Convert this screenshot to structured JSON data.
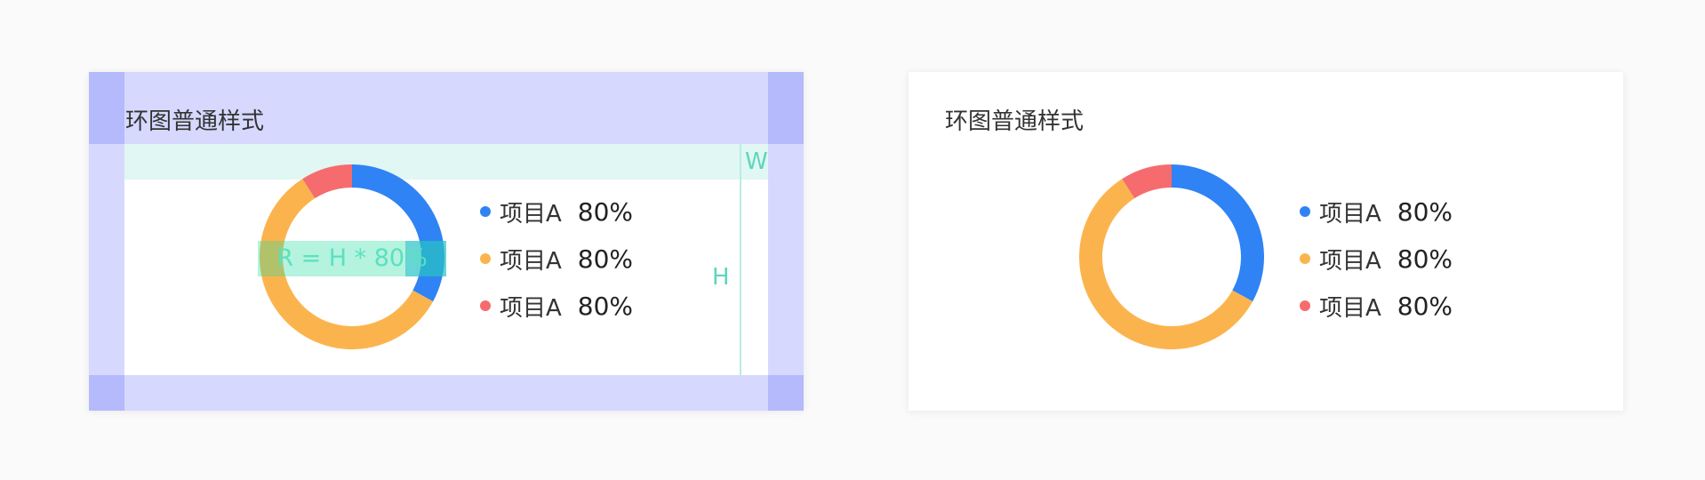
{
  "cards": [
    {
      "title": "环图普通样式",
      "annotations": {
        "width_label": "W",
        "height_label": "H",
        "radius_formula": "R = H * 80%"
      }
    },
    {
      "title": "环图普通样式"
    }
  ],
  "colors": {
    "blue": "#2f83f4",
    "orange": "#fbb44d",
    "red": "#f66b6e"
  },
  "chart_data": [
    {
      "type": "pie",
      "variant": "donut",
      "title": "环图普通样式",
      "slices": [
        {
          "label": "项目A",
          "value": 33,
          "color": "#2f83f4"
        },
        {
          "label": "项目A",
          "value": 58,
          "color": "#fbb44d"
        },
        {
          "label": "项目A",
          "value": 9,
          "color": "#f66b6e"
        }
      ],
      "legend": [
        {
          "name": "项目A",
          "value": "80%",
          "color": "#2f83f4"
        },
        {
          "name": "项目A",
          "value": "80%",
          "color": "#fbb44d"
        },
        {
          "name": "项目A",
          "value": "80%",
          "color": "#f66b6e"
        }
      ],
      "legend_position": "right"
    },
    {
      "type": "pie",
      "variant": "donut",
      "title": "环图普通样式",
      "slices": [
        {
          "label": "项目A",
          "value": 33,
          "color": "#2f83f4"
        },
        {
          "label": "项目A",
          "value": 58,
          "color": "#fbb44d"
        },
        {
          "label": "项目A",
          "value": 9,
          "color": "#f66b6e"
        }
      ],
      "legend": [
        {
          "name": "项目A",
          "value": "80%",
          "color": "#2f83f4"
        },
        {
          "name": "项目A",
          "value": "80%",
          "color": "#fbb44d"
        },
        {
          "name": "项目A",
          "value": "80%",
          "color": "#f66b6e"
        }
      ],
      "legend_position": "right"
    }
  ]
}
